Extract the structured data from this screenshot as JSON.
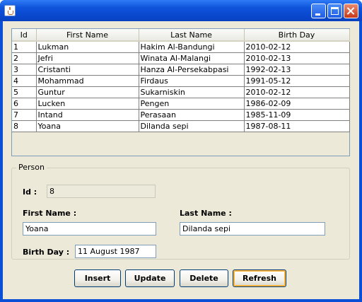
{
  "window": {
    "title": "",
    "icon": "java-coffee-icon",
    "controls": [
      "minimize",
      "maximize",
      "close"
    ]
  },
  "table": {
    "columns": [
      "Id",
      "First Name",
      "Last Name",
      "Birth Day"
    ],
    "rows": [
      [
        "1",
        "Lukman",
        "Hakim Al-Bandungi",
        "2010-02-12"
      ],
      [
        "2",
        "Jefri",
        "Winata Al-Malangi",
        "2010-02-13"
      ],
      [
        "3",
        "Cristanti",
        "Hanza Al-Persekabpasi",
        "1992-02-13"
      ],
      [
        "4",
        "Mohammad",
        "Firdaus",
        "1991-05-12"
      ],
      [
        "5",
        "Guntur",
        "Sukarniskin",
        "2010-02-12"
      ],
      [
        "6",
        "Lucken",
        "Pengen",
        "1986-02-09"
      ],
      [
        "7",
        "Intand",
        "Perasaan",
        "1985-11-09"
      ],
      [
        "8",
        "Yoana",
        "Dilanda sepi",
        "1987-08-11"
      ]
    ]
  },
  "person": {
    "legend": "Person",
    "id_label": "Id :",
    "id_value": "8",
    "first_name_label": "First Name :",
    "first_name_value": "Yoana",
    "last_name_label": "Last Name :",
    "last_name_value": "Dilanda sepi",
    "birth_day_label": "Birth Day :",
    "birth_day_value": "11 August 1987"
  },
  "buttons": {
    "insert": "Insert",
    "update": "Update",
    "delete": "Delete",
    "refresh": "Refresh"
  },
  "colors": {
    "titlebar": "#0a48cf",
    "panel": "#ece9d8",
    "field_border": "#7f9db9",
    "close_button": "#c8391a"
  }
}
